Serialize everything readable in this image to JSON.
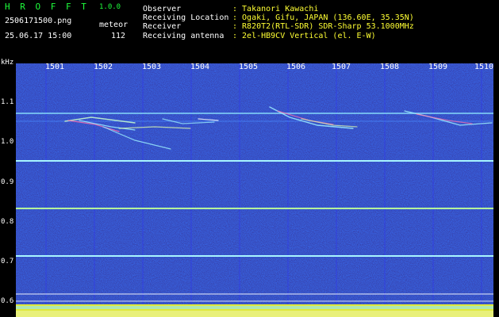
{
  "header": {
    "app_title": "H R O F F T",
    "version": "1.0.0",
    "filename": "2506171500.png",
    "datetime": "25.06.17 15:00",
    "mode_label": "meteor",
    "count": "112",
    "observer_label": "Observer",
    "observer_value": ": Takanori Kawachi",
    "location_label": "Receiving Location",
    "location_value": ": Ogaki, Gifu, JAPAN (136.60E, 35.35N)",
    "receiver_label": "Receiver",
    "receiver_value": ": R820T2(RTL-SDR) SDR-Sharp 53.1000MHz",
    "antenna_label": "Receiving antenna",
    "antenna_value": ": 2el-HB9CV Vertical (el. E-W)"
  },
  "axes": {
    "y_unit": "kHz",
    "y_ticks": [
      "1.1",
      "1.0",
      "0.9",
      "0.8",
      "0.7",
      "0.6"
    ],
    "x_ticks": [
      "1501",
      "1502",
      "1503",
      "1504",
      "1505",
      "1506",
      "1507",
      "1508",
      "1509",
      "1510"
    ]
  },
  "colors": {
    "background": "#0a0a6e",
    "trace": "#9cf0ff",
    "title": "#1eff3c",
    "value": "#ffff33"
  }
}
